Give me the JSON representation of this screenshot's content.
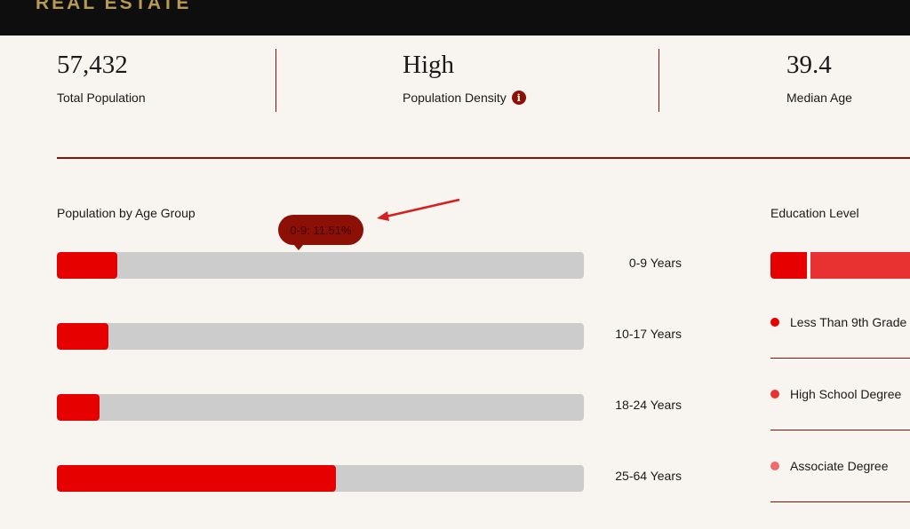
{
  "header": {
    "brand": "REAL ESTATE"
  },
  "stats": [
    {
      "value": "57,432",
      "label": "Total Population"
    },
    {
      "value": "High",
      "label": "Population Density"
    },
    {
      "value": "39.4",
      "label": "Median Age"
    }
  ],
  "age_section": {
    "title": "Population by Age Group",
    "tooltip": "0-9: 11.51%"
  },
  "chart_data": {
    "type": "bar",
    "categories": [
      "0-9 Years",
      "10-17 Years",
      "18-24 Years",
      "25-64 Years"
    ],
    "values": [
      11.51,
      9.8,
      8.1,
      53
    ],
    "xlim": [
      0,
      100
    ],
    "colors": {
      "fill": "#e60000",
      "track": "#cccccc"
    }
  },
  "education": {
    "title": "Education Level",
    "items": [
      {
        "label": "Less Than 9th Grade",
        "color": "#e60000"
      },
      {
        "label": "High School Degree",
        "color": "#e83232"
      },
      {
        "label": "Associate Degree",
        "color": "#ef6b6b"
      }
    ]
  },
  "colors": {
    "accent": "#8c1006",
    "background": "#f8f4ef",
    "brand": "#b89a55"
  }
}
